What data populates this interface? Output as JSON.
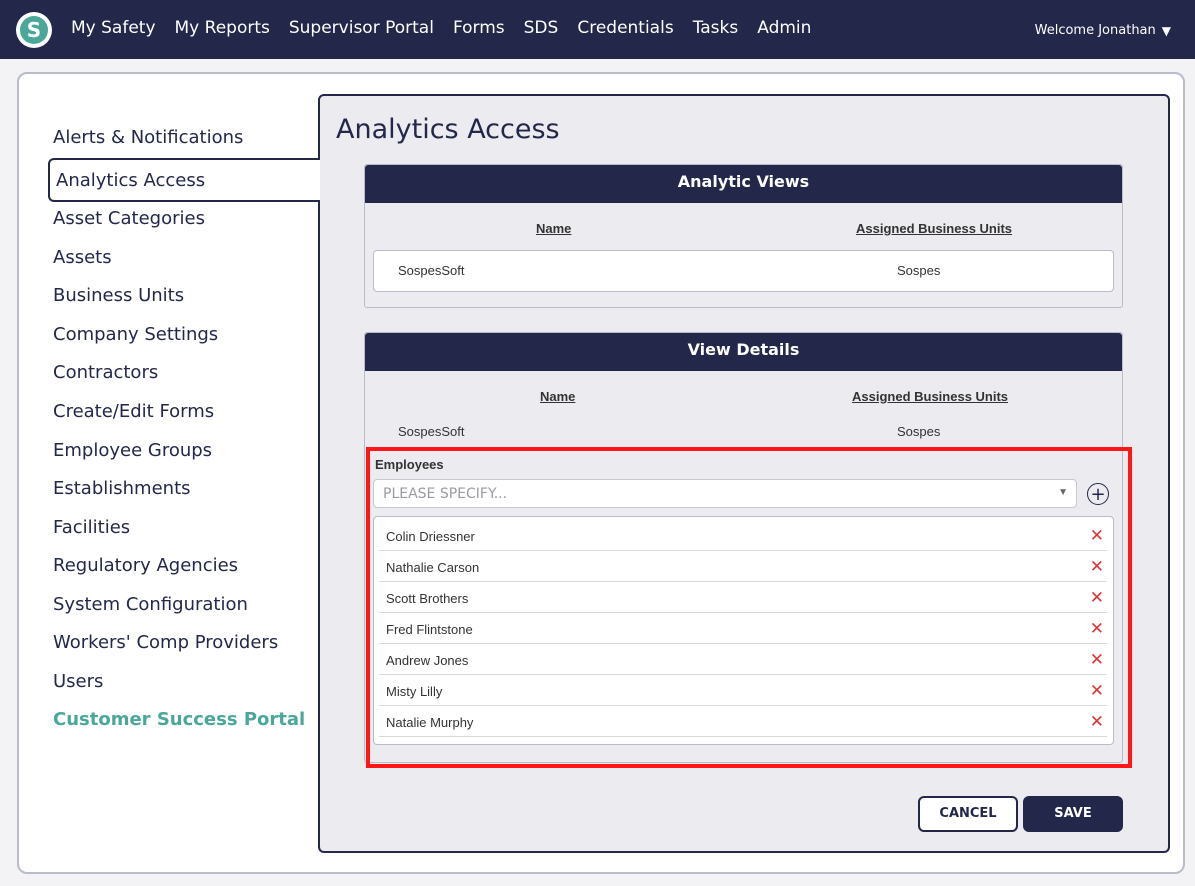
{
  "nav": {
    "logo_letter": "S",
    "links": [
      "My Safety",
      "My Reports",
      "Supervisor Portal",
      "Forms",
      "SDS",
      "Credentials",
      "Tasks",
      "Admin"
    ],
    "welcome": "Welcome Jonathan"
  },
  "sidebar": {
    "items": [
      "Alerts & Notifications",
      "Analytics Access",
      "Asset Categories",
      "Assets",
      "Business Units",
      "Company Settings",
      "Contractors",
      "Create/Edit Forms",
      "Employee Groups",
      "Establishments",
      "Facilities",
      "Regulatory Agencies",
      "System Configuration",
      "Workers' Comp Providers",
      "Users",
      "Customer Success Portal"
    ],
    "active": "Analytics Access"
  },
  "page": {
    "title": "Analytics Access"
  },
  "analytic_views": {
    "title": "Analytic Views",
    "col_name": "Name",
    "col_units": "Assigned Business Units",
    "row": {
      "name": "SospesSoft",
      "units": "Sospes"
    }
  },
  "view_details": {
    "title": "View Details",
    "col_name": "Name",
    "col_units": "Assigned Business Units",
    "row": {
      "name": "SospesSoft",
      "units": "Sospes"
    },
    "employees_label": "Employees",
    "employees_placeholder": "PLEASE SPECIFY...",
    "employees": [
      "Colin Driessner",
      "Nathalie Carson",
      "Scott Brothers",
      "Fred Flintstone",
      "Andrew Jones",
      "Misty Lilly",
      "Natalie Murphy"
    ]
  },
  "buttons": {
    "cancel": "CANCEL",
    "save": "SAVE"
  },
  "colors": {
    "navy": "#23274a",
    "teal": "#4aa79a",
    "remove_red": "#d93838",
    "highlight_red": "#ff1616"
  }
}
